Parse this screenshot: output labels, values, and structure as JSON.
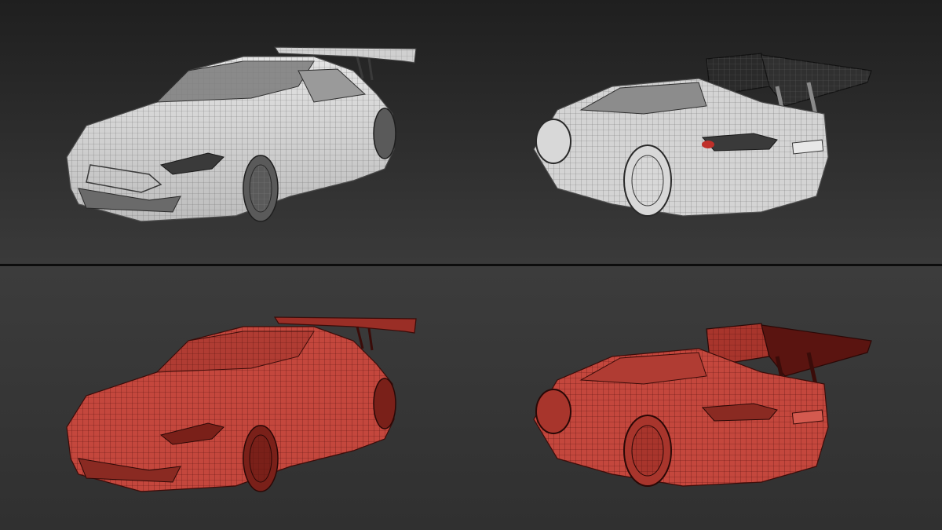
{
  "render": {
    "panels": [
      {
        "id": "top",
        "style": "clay-wireframe",
        "base_color": "#d8d8d8",
        "wire_color": "#6a6a6a",
        "accent": "#2a2a2a"
      },
      {
        "id": "bottom",
        "style": "red-wireframe",
        "base_color": "#c4473d",
        "wire_color": "#5a1410",
        "accent": "#3a0c09"
      }
    ],
    "views": [
      "front-three-quarter",
      "rear-three-quarter"
    ],
    "tail_light_color": "#c0302a",
    "background_top": "#2e2e2e",
    "background_bottom": "#353535",
    "divider_color": "#0d0d0d"
  }
}
